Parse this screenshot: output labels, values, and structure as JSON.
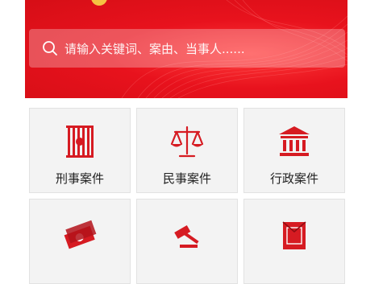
{
  "search": {
    "placeholder": "请输入关键词、案由、当事人......"
  },
  "categories": [
    {
      "label": "刑事案件",
      "icon": "prison-bars-icon"
    },
    {
      "label": "民事案件",
      "icon": "scales-icon"
    },
    {
      "label": "行政案件",
      "icon": "government-building-icon"
    },
    {
      "label": "",
      "icon": "money-bills-icon"
    },
    {
      "label": "",
      "icon": "gavel-icon"
    },
    {
      "label": "",
      "icon": "red-document-icon"
    }
  ],
  "colors": {
    "brand": "#e8121d",
    "icon": "#d61b22",
    "tile_bg": "#f3f3f3"
  }
}
